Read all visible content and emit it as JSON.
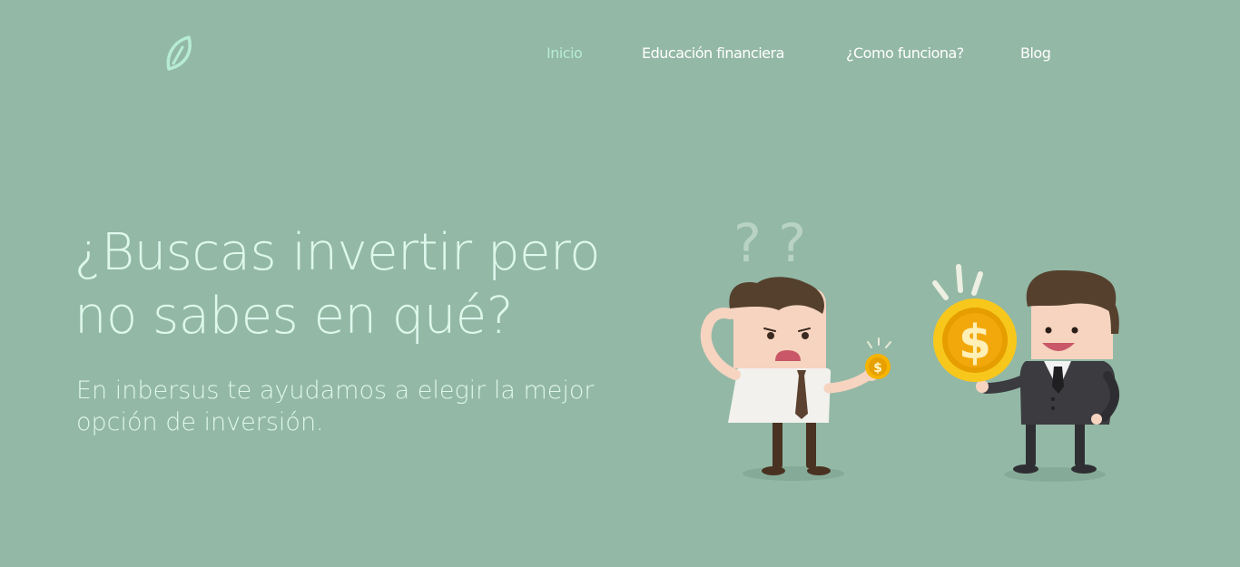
{
  "nav": {
    "items": [
      {
        "label": "Inicio",
        "active": true
      },
      {
        "label": "Educación financiera",
        "active": false
      },
      {
        "label": "¿Como funciona?",
        "active": false
      },
      {
        "label": "Blog",
        "active": false
      }
    ]
  },
  "hero": {
    "title": "¿Buscas invertir pero no sabes en qué?",
    "subtitle": "En inbersus te ayudamos a elegir la mejor opción de inversión."
  },
  "logo": {
    "icon": "leaf-icon"
  },
  "illustration": {
    "small_coin_symbol": "$",
    "big_coin_symbol": "$",
    "question_marks": "? ?"
  },
  "colors": {
    "background": "#93b8a6",
    "nav_active": "#b6ecd3",
    "nav_text": "#ffffff",
    "title_text": "#def8ec",
    "coin_gold": "#f5b400"
  }
}
